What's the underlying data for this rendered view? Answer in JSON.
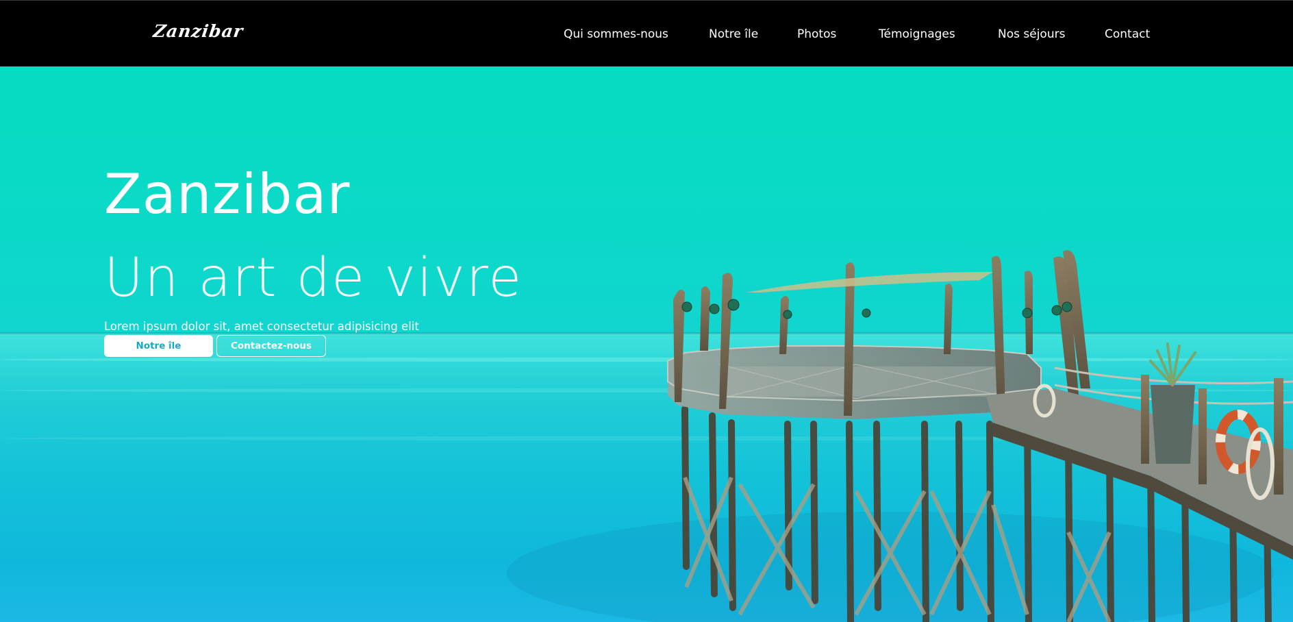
{
  "header": {
    "logo": "Zanzibar",
    "nav": [
      {
        "label": "Qui sommes-nous"
      },
      {
        "label": "Notre île"
      },
      {
        "label": "Photos"
      },
      {
        "label": "Témoignages"
      },
      {
        "label": "Nos séjours"
      },
      {
        "label": "Contact"
      }
    ]
  },
  "hero": {
    "title": "Zanzibar",
    "subtitle": "Un art de vivre",
    "lead": "Lorem ipsum dolor sit, amet consectetur adipisicing elit",
    "primary_button": "Notre île",
    "secondary_button": "Contactez-nous"
  },
  "colors": {
    "nav_background": "#000000",
    "hero_tint": "#05dcc2",
    "primary_button_text": "#14a9c4"
  }
}
